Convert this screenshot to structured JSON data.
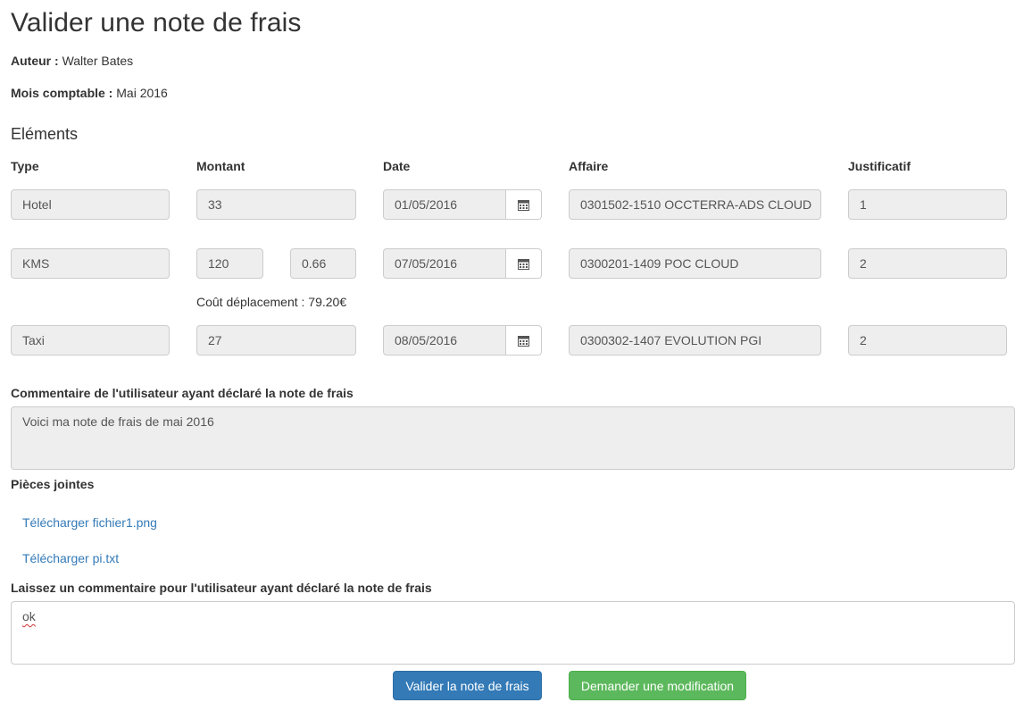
{
  "page": {
    "title": "Valider une note de frais",
    "auteur_label": "Auteur :",
    "auteur_value": "Walter Bates",
    "mois_label": "Mois comptable :",
    "mois_value": "Mai 2016"
  },
  "elements": {
    "heading": "Eléments",
    "columns": {
      "type": "Type",
      "montant": "Montant",
      "date": "Date",
      "affaire": "Affaire",
      "justificatif": "Justificatif"
    },
    "rows": [
      {
        "type": "Hotel",
        "montant": "33",
        "date": "01/05/2016",
        "affaire": "0301502-1510 OCCTERRA-ADS CLOUD",
        "justificatif": "1"
      },
      {
        "type": "KMS",
        "montant": "120",
        "taux": "0.66",
        "date": "07/05/2016",
        "affaire": "0300201-1409 POC CLOUD",
        "justificatif": "2",
        "cout": "Coût déplacement : 79.20€"
      },
      {
        "type": "Taxi",
        "montant": "27",
        "date": "08/05/2016",
        "affaire": "0300302-1407 EVOLUTION PGI",
        "justificatif": "2"
      }
    ],
    "calendar_icon": "calendar-icon"
  },
  "commentaire_utilisateur": {
    "label": "Commentaire de l'utilisateur ayant déclaré la note de frais",
    "value": "Voici ma note de frais de mai 2016"
  },
  "pieces_jointes": {
    "label": "Pièces jointes",
    "links": [
      "Télécharger fichier1.png",
      "Télécharger pi.txt"
    ]
  },
  "commentaire_validateur": {
    "label": "Laissez un commentaire pour l'utilisateur ayant déclaré la note de frais",
    "value": "ok"
  },
  "actions": {
    "valider": "Valider la note de frais",
    "modifier": "Demander une modification"
  },
  "colors": {
    "primary": "#337ab7",
    "success": "#5cb85c",
    "readonly_bg": "#eeeeee",
    "link": "#337ab7"
  }
}
